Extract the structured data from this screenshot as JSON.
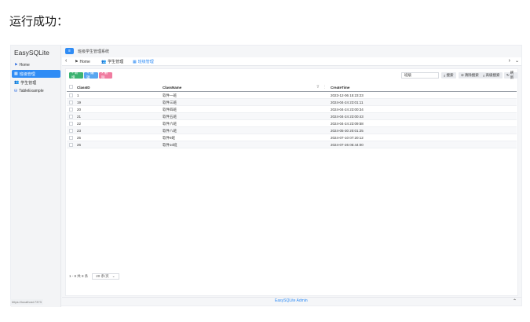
{
  "caption": "运行成功：",
  "app": {
    "brand": "EasySQLite",
    "sidebar": {
      "items": [
        {
          "label": "Home",
          "icon": "flag-icon"
        },
        {
          "label": "班级管理",
          "icon": "table-icon"
        },
        {
          "label": "学生管理",
          "icon": "users-icon"
        },
        {
          "label": "TableExample",
          "icon": "database-icon"
        }
      ]
    },
    "header": {
      "menu_icon": "menu-icon",
      "title": "班级学生管理系统"
    },
    "tabs": [
      {
        "label": "Home"
      },
      {
        "label": "学生管理"
      },
      {
        "label": "班级管理"
      }
    ],
    "toolbar": {
      "add_label": "+ 新增",
      "edit_label": "✎ 编辑",
      "delete_label": "× 删除",
      "search_value": "班级",
      "search_label": "搜索",
      "clear_label": "清除搜索",
      "advanced_label": "高级搜索",
      "refresh_label": "刷新"
    },
    "table": {
      "columns": [
        "ClassID",
        "ClassName",
        "CreateTime"
      ],
      "rows": [
        {
          "id": "1",
          "name": "软件一班",
          "time": "2023-12-06 15:23:23"
        },
        {
          "id": "19",
          "name": "软件三班",
          "time": "2024-04-24 23:01:11"
        },
        {
          "id": "20",
          "name": "软件四班",
          "time": "2024-04-24 23:00:34"
        },
        {
          "id": "21",
          "name": "软件五班",
          "time": "2024-04-24 23:00:43"
        },
        {
          "id": "22",
          "name": "软件六班",
          "time": "2024-04-24 23:09:58"
        },
        {
          "id": "23",
          "name": "软件八班",
          "time": "2024-05-30 20:01:25"
        },
        {
          "id": "25",
          "name": "软件9班",
          "time": "2024-07-10 07:20:12"
        },
        {
          "id": "26",
          "name": "软件10班",
          "time": "2024-07-26 06:44:00"
        }
      ]
    },
    "pager": {
      "summary": "1 - 8 共 8 条",
      "page_size": "20 条/页"
    },
    "footer": {
      "url": "https://localhost:7373",
      "brand": "EasySQLite Admin"
    }
  }
}
